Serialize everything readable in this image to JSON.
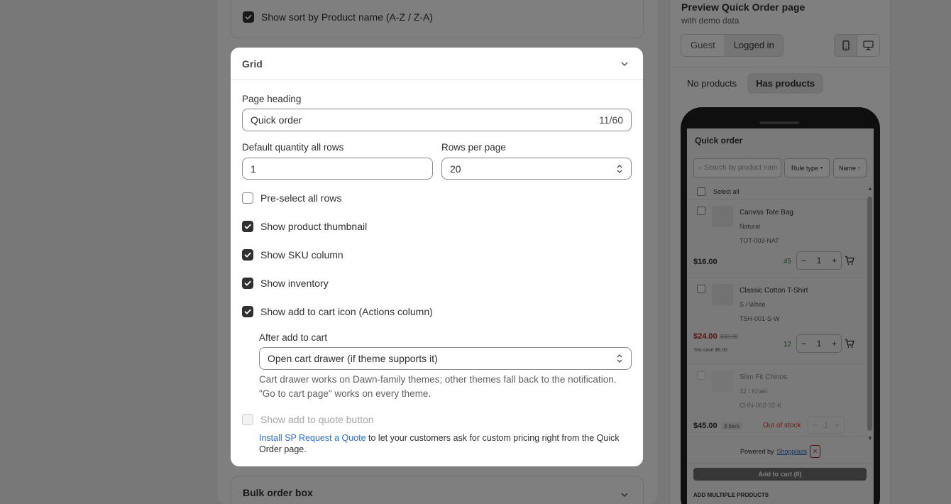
{
  "background": {
    "sort_option_label": "Show sort by Product name (A-Z / Z-A)",
    "bulk_order_title": "Bulk order box"
  },
  "grid_modal": {
    "title": "Grid",
    "page_heading_label": "Page heading",
    "page_heading_value": "Quick order",
    "page_heading_counter": "11/60",
    "default_qty_label": "Default quantity all rows",
    "default_qty_value": "1",
    "rows_per_page_label": "Rows per page",
    "rows_per_page_value": "20",
    "preselect_label": "Pre-select all rows",
    "preselect_checked": false,
    "show_thumbnail_label": "Show product thumbnail",
    "show_thumbnail_checked": true,
    "show_sku_label": "Show SKU column",
    "show_sku_checked": true,
    "show_inventory_label": "Show inventory",
    "show_inventory_checked": true,
    "show_cart_icon_label": "Show add to cart icon (Actions column)",
    "show_cart_icon_checked": true,
    "after_add_label": "After add to cart",
    "after_add_value": "Open cart drawer (if theme supports it)",
    "after_add_help": "Cart drawer works on Dawn-family themes; other themes fall back to the notification. \"Go to cart page\" works on every theme.",
    "quote_button_label": "Show add to quote button",
    "quote_button_disabled": true,
    "install_link": "Install SP Request a Quote",
    "install_text": " to let your customers ask for custom pricing right from the Quick Order page."
  },
  "preview": {
    "title": "Preview Quick Order page",
    "subtitle": "with demo data",
    "tabs_user": [
      "Guest",
      "Logged in"
    ],
    "active_user_tab": "Logged in",
    "tabs_products": [
      "No products",
      "Has products"
    ],
    "active_products_tab": "Has products",
    "device_icons": [
      "mobile-icon",
      "desktop-icon"
    ],
    "phone": {
      "heading": "Quick order",
      "search_placeholder": "Search by product nam",
      "rule_type": "Rule type",
      "name_sort": "Name ↑",
      "select_all": "Select all",
      "products": [
        {
          "name": "Canvas Tote Bag",
          "variant": "Natural",
          "sku": "TOT-003-NAT",
          "price": "$16.00",
          "inventory": "45",
          "qty": "1"
        },
        {
          "name": "Classic Cotton T-Shirt",
          "variant": "S / White",
          "sku": "TSH-001-S-W",
          "price": "$24.00",
          "compare_price": "$30.00",
          "savings": "You save $6.00",
          "inventory": "12",
          "qty": "1"
        },
        {
          "name": "Slim Fit Chinos",
          "variant": "32 / Khaki",
          "sku": "CHN-002-32-K",
          "price": "$45.00",
          "tiers": "3 tiers",
          "stock_status": "Out of stock",
          "qty": "1"
        }
      ],
      "powered_by": "Powered by",
      "powered_brand": "Shopplaza",
      "add_to_cart": "Add to cart (0)",
      "add_multiple": "ADD MULTIPLE PRODUCTS"
    }
  },
  "colors": {
    "sale_price": "#b3261e",
    "inventory_green": "#2e7d32",
    "link_blue": "#2c6ecb",
    "out_of_stock": "#d8372b"
  }
}
